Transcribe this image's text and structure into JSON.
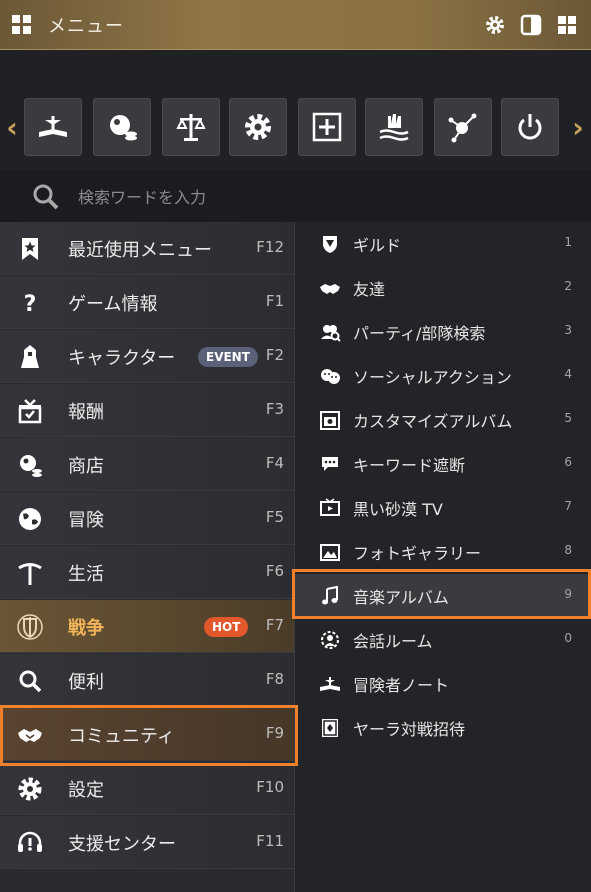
{
  "header": {
    "title": "メニュー",
    "icons": [
      "grid-icon",
      "gear-icon",
      "panel-icon",
      "grid-icon"
    ]
  },
  "quickbar": {
    "icons": [
      "book-icon",
      "shop-icon",
      "scales-icon",
      "gear-icon",
      "add-frame-icon",
      "water-hand-icon",
      "network-icon",
      "power-icon"
    ]
  },
  "search": {
    "placeholder": "検索ワードを入力"
  },
  "left_menu": [
    {
      "label": "最近使用メニュー",
      "key": "F12",
      "icon": "bookmark-star-icon"
    },
    {
      "label": "ゲーム情報",
      "key": "F1",
      "icon": "question-icon"
    },
    {
      "label": "キャラクター",
      "key": "F2",
      "icon": "knight-icon",
      "badge": "EVENT"
    },
    {
      "label": "報酬",
      "key": "F3",
      "icon": "gift-icon"
    },
    {
      "label": "商店",
      "key": "F4",
      "icon": "shop-icon"
    },
    {
      "label": "冒険",
      "key": "F5",
      "icon": "globe-icon"
    },
    {
      "label": "生活",
      "key": "F6",
      "icon": "pickaxe-icon"
    },
    {
      "label": "戦争",
      "key": "F7",
      "icon": "shield-sword-icon",
      "badge": "HOT"
    },
    {
      "label": "便利",
      "key": "F8",
      "icon": "search-icon"
    },
    {
      "label": "コミュニティ",
      "key": "F9",
      "icon": "handshake-icon"
    },
    {
      "label": "設定",
      "key": "F10",
      "icon": "gear-icon"
    },
    {
      "label": "支援センター",
      "key": "F11",
      "icon": "headset-icon"
    }
  ],
  "right_menu": [
    {
      "label": "ギルド",
      "num": "1",
      "icon": "guild-icon"
    },
    {
      "label": "友達",
      "num": "2",
      "icon": "handshake-icon"
    },
    {
      "label": "パーティ/部隊検索",
      "num": "3",
      "icon": "party-search-icon"
    },
    {
      "label": "ソーシャルアクション",
      "num": "4",
      "icon": "emote-icon"
    },
    {
      "label": "カスタマイズアルバム",
      "num": "5",
      "icon": "camera-icon"
    },
    {
      "label": "キーワード遮断",
      "num": "6",
      "icon": "chat-block-icon"
    },
    {
      "label": "黒い砂漠 TV",
      "num": "7",
      "icon": "tv-icon"
    },
    {
      "label": "フォトギャラリー",
      "num": "8",
      "icon": "picture-icon"
    },
    {
      "label": "音楽アルバム",
      "num": "9",
      "icon": "music-note-icon"
    },
    {
      "label": "会話ルーム",
      "num": "0",
      "icon": "talk-room-icon"
    },
    {
      "label": "冒険者ノート",
      "num": "",
      "icon": "book-icon"
    },
    {
      "label": "ヤーラ対戦招待",
      "num": "",
      "icon": "card-icon"
    }
  ],
  "colors": {
    "accent": "#f0802a",
    "gold": "#c9a35a",
    "hot": "#e0582c",
    "event": "#5a6178"
  }
}
